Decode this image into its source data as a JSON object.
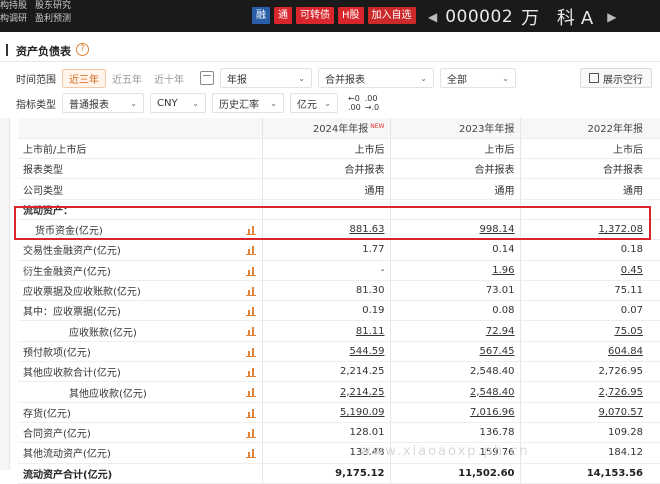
{
  "topnav": {
    "row1": [
      "构持股",
      "股东研究"
    ],
    "row2": [
      "构调研",
      "盈利预测"
    ]
  },
  "badges": [
    "融",
    "通",
    "可转债",
    "H股",
    "加入自选"
  ],
  "stock": {
    "code": "000002",
    "name": "万 科A",
    "arrow_left": "◀",
    "arrow_right": "▶"
  },
  "page_title": "资产负债表",
  "help_icon": "?",
  "filters": {
    "time_range_label": "时间范围",
    "time_options": [
      "近三年",
      "近五年",
      "近十年"
    ],
    "report_period": "年报",
    "statement_type": "合并报表",
    "scope": "全部",
    "show_empty_button": "展示空行",
    "indicator_label": "指标类型",
    "indicator_type": "普通报表",
    "currency": "CNY",
    "rate": "历史汇率",
    "unit": "亿元",
    "decimals_top": [
      "←0",
      ".00"
    ],
    "decimals_bottom": [
      ".00",
      "→.0"
    ]
  },
  "table": {
    "columns": [
      "",
      "2024年年报",
      "2023年年报",
      "2022年年报"
    ],
    "new_tag": "NEW",
    "rows": [
      {
        "name": "上市前/上市后",
        "values": [
          "上市后",
          "上市后",
          "上市后"
        ]
      },
      {
        "name": "报表类型",
        "values": [
          "合并报表",
          "合并报表",
          "合并报表"
        ]
      },
      {
        "name": "公司类型",
        "values": [
          "通用",
          "通用",
          "通用"
        ]
      },
      {
        "name": "流动资产：",
        "values": [
          "",
          "",
          ""
        ]
      },
      {
        "name": "货币资金(亿元)",
        "values": [
          "881.63",
          "998.14",
          "1,372.08"
        ]
      },
      {
        "name": "交易性金融资产(亿元)",
        "values": [
          "1.77",
          "0.14",
          "0.18"
        ]
      },
      {
        "name": "衍生金融资产(亿元)",
        "values": [
          "-",
          "1.96",
          "0.45"
        ]
      },
      {
        "name": "应收票据及应收账款(亿元)",
        "values": [
          "81.30",
          "73.01",
          "75.11"
        ]
      },
      {
        "name": "其中：应收票据(亿元)",
        "values": [
          "0.19",
          "0.08",
          "0.07"
        ]
      },
      {
        "name": "应收账款(亿元)",
        "values": [
          "81.11",
          "72.94",
          "75.05"
        ]
      },
      {
        "name": "预付款项(亿元)",
        "values": [
          "544.59",
          "567.45",
          "604.84"
        ]
      },
      {
        "name": "其他应收款合计(亿元)",
        "values": [
          "2,214.25",
          "2,548.40",
          "2,726.95"
        ]
      },
      {
        "name": "其他应收款(亿元)",
        "values": [
          "2,214.25",
          "2,548.40",
          "2,726.95"
        ]
      },
      {
        "name": "存货(亿元)",
        "values": [
          "5,190.09",
          "7,016.96",
          "9,070.57"
        ]
      },
      {
        "name": "合同资产(亿元)",
        "values": [
          "128.01",
          "136.78",
          "109.28"
        ]
      },
      {
        "name": "其他流动资产(亿元)",
        "values": [
          "133.48",
          "159.76",
          "184.12"
        ]
      },
      {
        "name": "流动资产合计(亿元)",
        "values": [
          "9,175.12",
          "11,502.60",
          "14,153.56"
        ]
      }
    ]
  },
  "watermark": "www.xiaoaoxp.ph.cn"
}
